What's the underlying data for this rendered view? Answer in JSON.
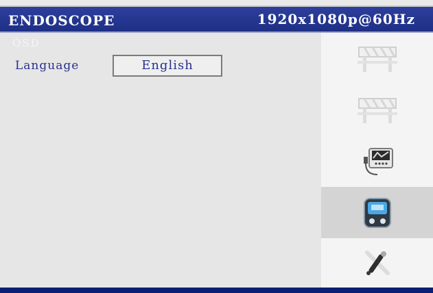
{
  "header": {
    "title": "ENDOSCOPE",
    "resolution": "1920x1080p@60Hz"
  },
  "content": {
    "section_label": "OSD",
    "language_label": "Language",
    "language_value": "English"
  },
  "sidebar": {
    "items": [
      {
        "icon": "roadblock-icon",
        "active": false
      },
      {
        "icon": "roadblock-icon",
        "active": false
      },
      {
        "icon": "monitor-device-icon",
        "active": false
      },
      {
        "icon": "osd-display-icon",
        "active": true
      },
      {
        "icon": "tools-icon",
        "active": false
      }
    ]
  },
  "colors": {
    "title_bar": "#1e2f86",
    "text_accent": "#2a2f8f",
    "active_item": "#d4d4d4"
  }
}
